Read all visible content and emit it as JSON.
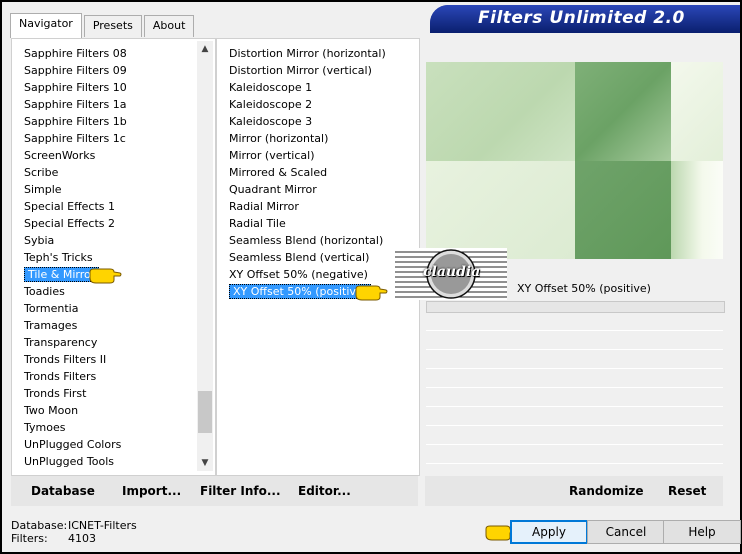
{
  "window": {
    "title": "Filters Unlimited 2.0"
  },
  "tabs": [
    {
      "label": "Navigator",
      "active": true
    },
    {
      "label": "Presets",
      "active": false
    },
    {
      "label": "About",
      "active": false
    }
  ],
  "categories": {
    "items": [
      "Sapphire Filters 08",
      "Sapphire Filters 09",
      "Sapphire Filters 10",
      "Sapphire Filters 1a",
      "Sapphire Filters 1b",
      "Sapphire Filters 1c",
      "ScreenWorks",
      "Scribe",
      "Simple",
      "Special Effects 1",
      "Special Effects 2",
      "Sybia",
      "Teph's Tricks",
      "Tile & Mirror",
      "Toadies",
      "Tormentia",
      "Tramages",
      "Transparency",
      "Tronds Filters II",
      "Tronds Filters",
      "Tronds First",
      "Two Moon",
      "Tymoes",
      "UnPlugged Colors",
      "UnPlugged Tools"
    ],
    "selected": "Tile & Mirror"
  },
  "filters": {
    "items": [
      "Distortion Mirror (horizontal)",
      "Distortion Mirror (vertical)",
      "Kaleidoscope 1",
      "Kaleidoscope 2",
      "Kaleidoscope 3",
      "Mirror (horizontal)",
      "Mirror (vertical)",
      "Mirrored & Scaled",
      "Quadrant Mirror",
      "Radial Mirror",
      "Radial Tile",
      "Seamless Blend (horizontal)",
      "Seamless Blend (vertical)",
      "XY Offset 50% (negative)",
      "XY Offset 50% (positive)"
    ],
    "selected": "XY Offset 50% (positive)"
  },
  "preview": {
    "filter_name": "XY Offset 50% (positive)"
  },
  "watermark": {
    "text": "claudia"
  },
  "bottom_left_buttons": {
    "database": "Database",
    "import": "Import...",
    "filter_info": "Filter Info...",
    "editor": "Editor..."
  },
  "bottom_right_buttons": {
    "randomize": "Randomize",
    "reset": "Reset"
  },
  "status": {
    "database_label": "Database:",
    "database_value": "ICNET-Filters",
    "filters_label": "Filters:",
    "filters_value": "4103"
  },
  "dialog_buttons": {
    "apply": "Apply",
    "cancel": "Cancel",
    "help": "Help"
  },
  "colors": {
    "selection": "#3399ff",
    "banner": "#0f2a8a",
    "preview_light": "#dfeed5",
    "preview_dark": "#6fa36a",
    "pointer": "#ffd400"
  }
}
